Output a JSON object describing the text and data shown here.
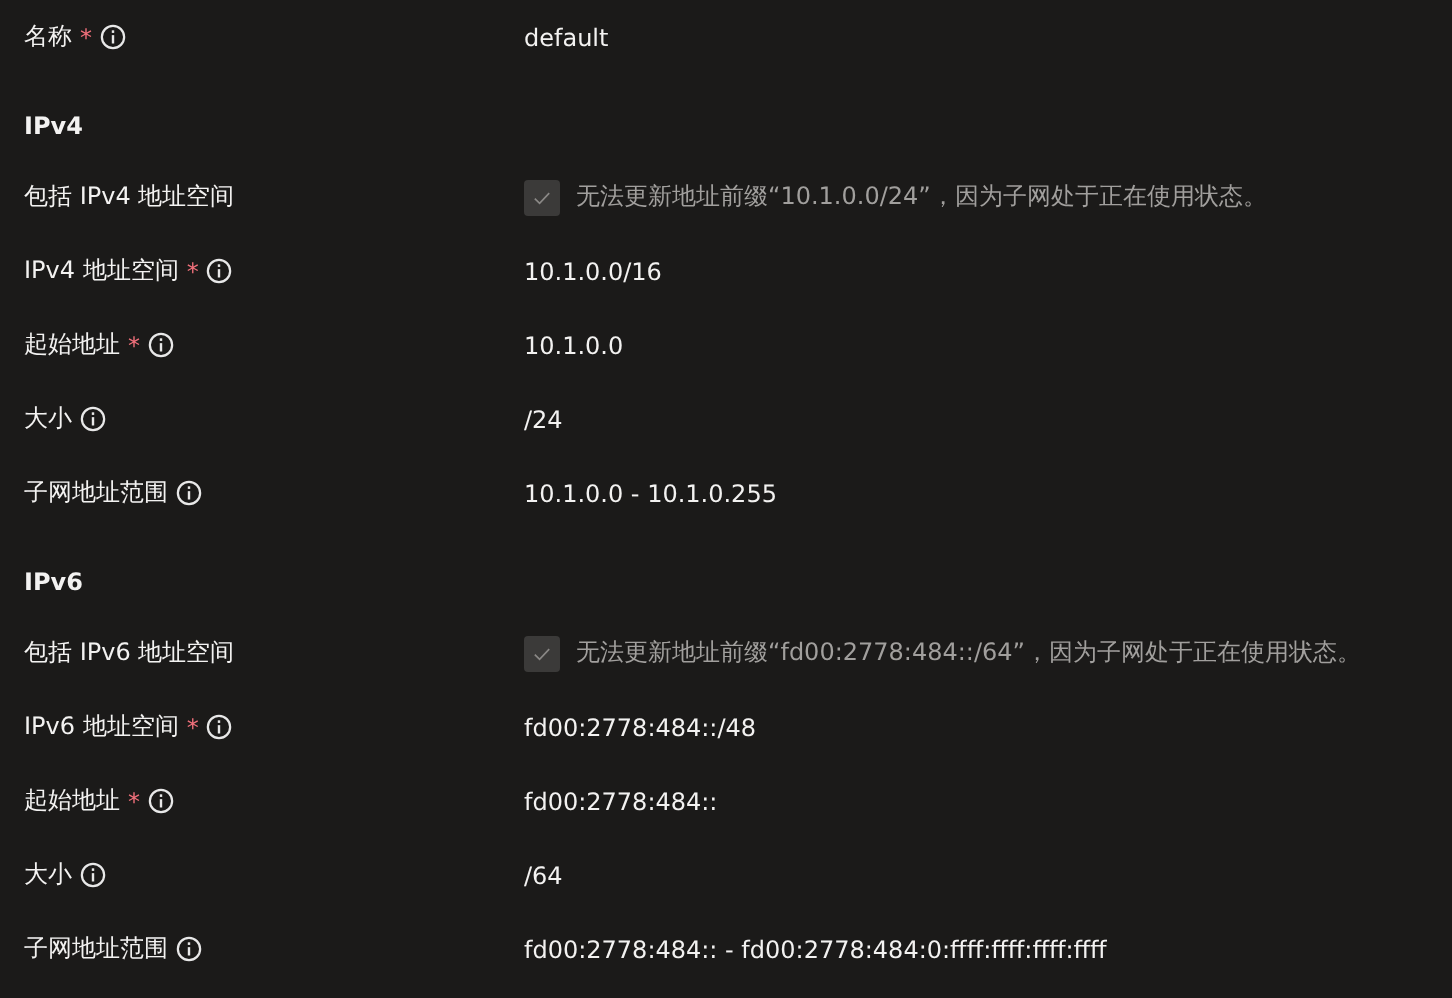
{
  "sections": [
    {
      "rows": [
        {
          "kind": "text",
          "label": "名称",
          "required_mark": "*",
          "info": true,
          "value": "default"
        }
      ]
    },
    {
      "heading": "IPv4",
      "rows": [
        {
          "kind": "checkbox",
          "label": "包括 IPv4 地址空间",
          "info": false,
          "checked": true,
          "disabled": true,
          "value": "无法更新地址前缀“10.1.0.0/24”，因为子网处于正在使用状态。"
        },
        {
          "kind": "text",
          "label": "IPv4 地址空间",
          "required_mark": "*",
          "info": true,
          "value": "10.1.0.0/16"
        },
        {
          "kind": "text",
          "label": "起始地址",
          "required_mark": "*",
          "info": true,
          "value": "10.1.0.0"
        },
        {
          "kind": "text",
          "label": "大小",
          "info": true,
          "value": "/24"
        },
        {
          "kind": "text",
          "label": "子网地址范围",
          "info": true,
          "value": "10.1.0.0 - 10.1.0.255"
        }
      ]
    },
    {
      "heading": "IPv6",
      "rows": [
        {
          "kind": "checkbox",
          "label": "包括 IPv6 地址空间",
          "info": false,
          "checked": true,
          "disabled": true,
          "value": "无法更新地址前缀“fd00:2778:484::/64”，因为子网处于正在使用状态。"
        },
        {
          "kind": "text",
          "label": "IPv6 地址空间",
          "required_mark": "*",
          "info": true,
          "value": "fd00:2778:484::/48"
        },
        {
          "kind": "text",
          "label": "起始地址",
          "required_mark": "*",
          "info": true,
          "value": "fd00:2778:484::"
        },
        {
          "kind": "text",
          "label": "大小",
          "info": true,
          "value": "/64"
        },
        {
          "kind": "text",
          "label": "子网地址范围",
          "info": true,
          "value": "fd00:2778:484:: - fd00:2778:484:0:ffff:ffff:ffff:ffff"
        }
      ]
    }
  ]
}
